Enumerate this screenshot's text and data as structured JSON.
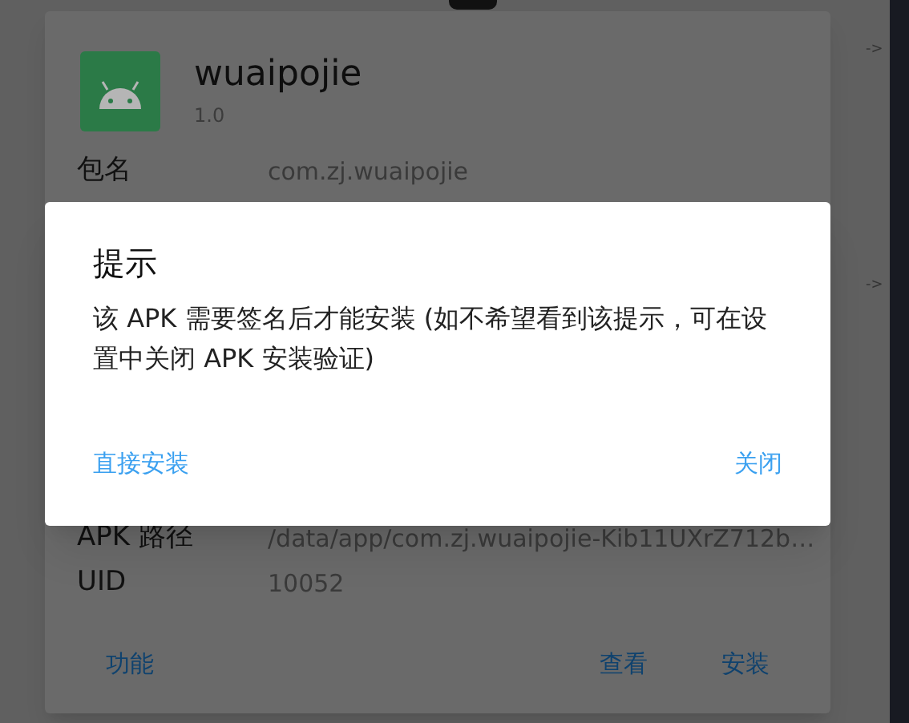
{
  "background_list": {
    "items": [
      {
        "kind": "thumbnail"
      }
    ]
  },
  "side_panel": {
    "arrows": [
      "->",
      "->"
    ]
  },
  "app_card": {
    "name": "wuaipojie",
    "version": "1.0",
    "rows": [
      {
        "label": "包名",
        "value": "com.zj.wuaipojie"
      },
      {
        "label": "APK 路径",
        "value": "/data/app/com.zj.wuaipojie-Kib11UXrZ712b…"
      },
      {
        "label": "UID",
        "value": "10052"
      }
    ],
    "buttons": [
      "功能",
      "查看",
      "安装"
    ]
  },
  "dialog": {
    "title": "提示",
    "message": "该 APK 需要签名后才能安装 (如不希望看到该提示，可在设置中关闭 APK 安装验证)",
    "buttons": [
      "直接安装",
      "关闭"
    ]
  }
}
